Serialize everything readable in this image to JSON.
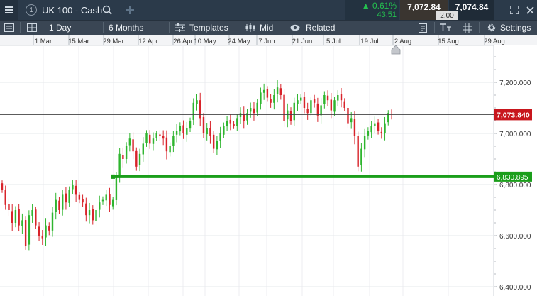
{
  "header": {
    "instrument_number": "1",
    "instrument_name": "UK 100 - Cash",
    "change_percent": "0.61%",
    "change_abs": "43.51",
    "sell_price": "7,072.84",
    "buy_price": "7,074.84",
    "spread": "2.00",
    "up_arrow": "▲"
  },
  "toolbar": {
    "interval": "1 Day",
    "period": "6 Months",
    "templates": "Templates",
    "price_type": "Mid",
    "related": "Related",
    "settings": "Settings"
  },
  "icons": {
    "menu": "hamburger-menu-icon",
    "search": "search-icon",
    "add": "plus-icon",
    "expand": "expand-icon",
    "close": "close-icon",
    "sidebar": "sidebar-toggle-icon",
    "layout": "layout-grid-icon",
    "templates": "templates-sliders-icon",
    "price_type": "candlestick-icon",
    "related": "eye-icon",
    "notes": "notes-icon",
    "text": "text-tool-icon",
    "grid": "grid-icon",
    "settings": "gear-icon"
  },
  "colors": {
    "up": "#2eb52e",
    "down": "#d8232a",
    "current_price_tag": "#c8161d",
    "support_line": "#1a9e1a"
  },
  "chart_data": {
    "type": "candlestick",
    "x_ticks": [
      "1 Mar",
      "15 Mar",
      "29 Mar",
      "12 Apr",
      "26 Apr",
      "10 May",
      "24 May",
      "7 Jun",
      "21 Jun",
      "5 Jul",
      "19 Jul",
      "2 Aug",
      "15 Aug",
      "29 Aug"
    ],
    "y_ticks": [
      "6,400.000",
      "6,600.000",
      "6,800.000",
      "7,000.000",
      "7,200.000"
    ],
    "y_tick_values": [
      6400,
      6600,
      6800,
      7000,
      7200
    ],
    "ylim": [
      6380,
      7320
    ],
    "current_price": 7073.84,
    "current_price_label": "7,073.840",
    "support_level": 6830.895,
    "support_label": "6,830.895",
    "grid": true,
    "closes": [
      6780,
      6720,
      6700,
      6650,
      6700,
      6640,
      6660,
      6560,
      6680,
      6700,
      6640,
      6600,
      6590,
      6640,
      6620,
      6690,
      6740,
      6700,
      6760,
      6730,
      6780,
      6800,
      6760,
      6740,
      6730,
      6680,
      6700,
      6660,
      6700,
      6730,
      6740,
      6760,
      6720,
      6740,
      6830,
      6920,
      6900,
      6950,
      6980,
      6930,
      6870,
      6920,
      6960,
      7000,
      6960,
      6980,
      7000,
      6990,
      6980,
      6930,
      6950,
      6990,
      7010,
      7030,
      7000,
      7020,
      7050,
      7120,
      7130,
      7060,
      7000,
      7020,
      6990,
      6940,
      6970,
      7000,
      7030,
      7050,
      7040,
      7030,
      7060,
      7080,
      7050,
      7080,
      7100,
      7080,
      7120,
      7160,
      7170,
      7140,
      7120,
      7150,
      7180,
      7150,
      7050,
      7090,
      7050,
      7120,
      7130,
      7140,
      7100,
      7080,
      7130,
      7120,
      7070,
      7110,
      7150,
      7130,
      7090,
      7130,
      7150,
      7130,
      7100,
      7040,
      7060,
      6990,
      6870,
      6940,
      6990,
      7010,
      7030,
      7040,
      7010,
      7000,
      7040,
      7080,
      7073.84
    ]
  }
}
